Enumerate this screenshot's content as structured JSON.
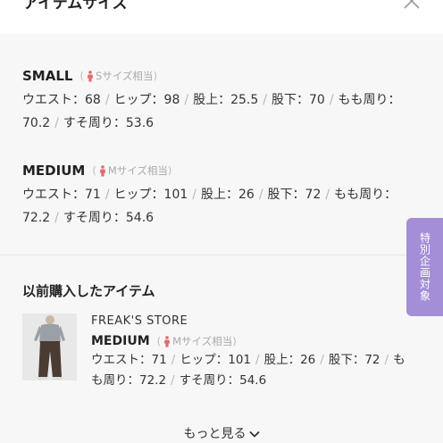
{
  "header": {
    "title": "アイテムサイズ"
  },
  "sizes": [
    {
      "name": "SMALL",
      "equivalent": "Sサイズ相当",
      "measurements": [
        {
          "label": "ウエスト",
          "value": "68"
        },
        {
          "label": "ヒップ",
          "value": "98"
        },
        {
          "label": "股上",
          "value": "25.5"
        },
        {
          "label": "股下",
          "value": "70"
        },
        {
          "label": "もも周り",
          "value": "70.2"
        },
        {
          "label": "すそ周り",
          "value": "53.6"
        }
      ]
    },
    {
      "name": "MEDIUM",
      "equivalent": "Mサイズ相当",
      "measurements": [
        {
          "label": "ウエスト",
          "value": "71"
        },
        {
          "label": "ヒップ",
          "value": "101"
        },
        {
          "label": "股上",
          "value": "26"
        },
        {
          "label": "股下",
          "value": "72"
        },
        {
          "label": "もも周り",
          "value": "72.2"
        },
        {
          "label": "すそ周り",
          "value": "54.6"
        }
      ]
    }
  ],
  "special_tab": {
    "label": "特別企画対象"
  },
  "previous": {
    "title": "以前購入したアイテム",
    "brand": "FREAK'S STORE",
    "size": "MEDIUM",
    "equivalent": "Mサイズ相当",
    "measurements": [
      {
        "label": "ウエスト",
        "value": "71"
      },
      {
        "label": "ヒップ",
        "value": "101"
      },
      {
        "label": "股上",
        "value": "26"
      },
      {
        "label": "股下",
        "value": "72"
      },
      {
        "label": "もも周り",
        "value": "72.2"
      },
      {
        "label": "すそ周り",
        "value": "54.6"
      }
    ]
  },
  "more_label": "もっと見る",
  "symbols": {
    "open_paren": "(",
    "close_paren": ")",
    "colon": "：",
    "separator": "/"
  },
  "colors": {
    "accent_purple": "#a48ed8",
    "person_icon": "#e06b6b",
    "background": "#f7f7f7"
  },
  "icons": {
    "close": "close-icon",
    "person": "person-icon",
    "chevron": "chevron-down-icon"
  }
}
